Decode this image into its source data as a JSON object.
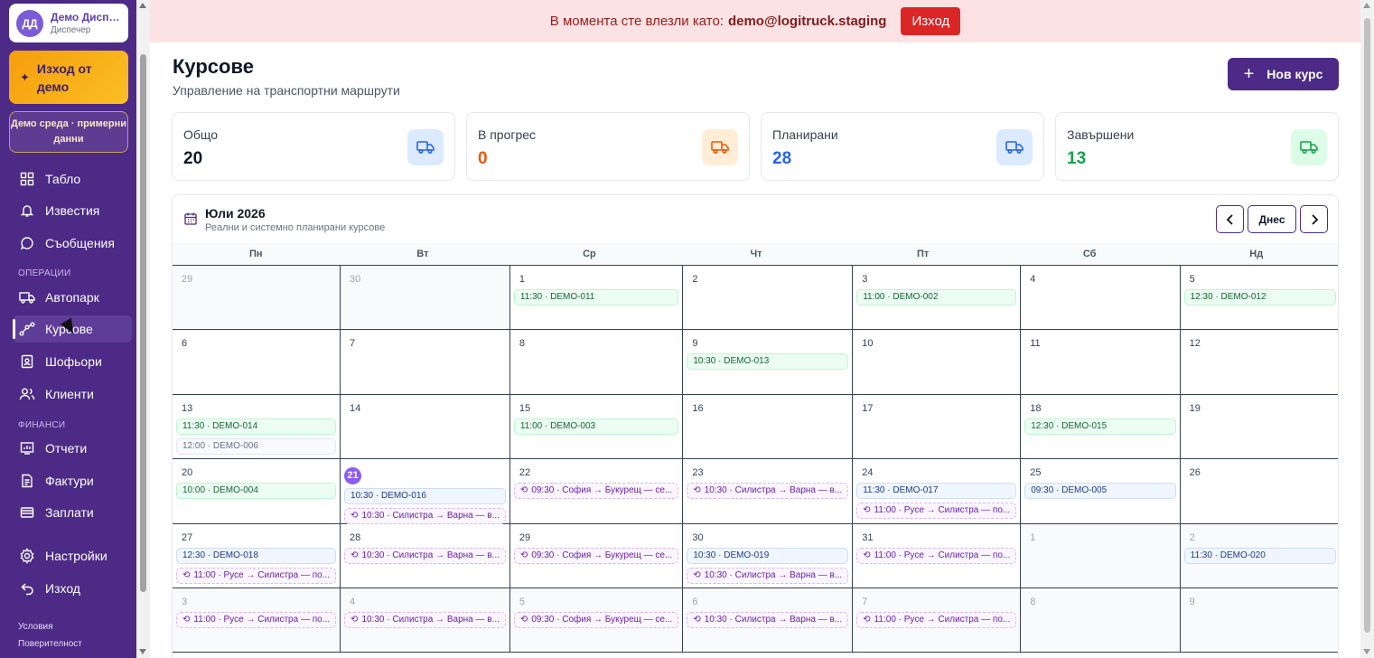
{
  "user": {
    "initials": "ДД",
    "name": "Демо Диспечер",
    "role": "Диспечер"
  },
  "sidebar": {
    "exit_demo": "Изход от демо",
    "demo_env": "Демо среда · примерни данни",
    "items_top": [
      {
        "label": "Табло",
        "icon": "dashboard-icon"
      },
      {
        "label": "Известия",
        "icon": "bell-icon"
      },
      {
        "label": "Съобщения",
        "icon": "chat-icon"
      }
    ],
    "section_operations": "ОПЕРАЦИИ",
    "items_ops": [
      {
        "label": "Автопарк",
        "icon": "truck-icon"
      },
      {
        "label": "Курсове",
        "icon": "route-icon"
      },
      {
        "label": "Шофьори",
        "icon": "id-badge-icon"
      },
      {
        "label": "Клиенти",
        "icon": "users-icon"
      }
    ],
    "section_finance": "ФИНАНСИ",
    "items_fin": [
      {
        "label": "Отчети",
        "icon": "report-icon"
      },
      {
        "label": "Фактури",
        "icon": "invoice-icon"
      },
      {
        "label": "Заплати",
        "icon": "wallet-icon"
      }
    ],
    "items_bottom": [
      {
        "label": "Настройки",
        "icon": "gear-icon"
      },
      {
        "label": "Изход",
        "icon": "logout-icon"
      }
    ],
    "footer": [
      "Условия",
      "Поверителност"
    ]
  },
  "banner": {
    "text": "В момента сте влезли като:",
    "email": "demo@logitruck.staging",
    "logout": "Изход"
  },
  "header": {
    "title": "Курсове",
    "subtitle": "Управление на транспортни маршрути",
    "new_button": "Нов курс"
  },
  "stats": [
    {
      "label": "Общо",
      "value": "20",
      "color": "#111827",
      "icon_bg": "#dbeafe",
      "icon_color": "#2563eb"
    },
    {
      "label": "В прогрес",
      "value": "0",
      "color": "#ea580c",
      "icon_bg": "#ffedd5",
      "icon_color": "#ea580c"
    },
    {
      "label": "Планирани",
      "value": "28",
      "color": "#2563eb",
      "icon_bg": "#dbeafe",
      "icon_color": "#2563eb"
    },
    {
      "label": "Завършени",
      "value": "13",
      "color": "#16a34a",
      "icon_bg": "#dcfce7",
      "icon_color": "#16a34a"
    }
  ],
  "calendar": {
    "title": "Юли 2026",
    "subtitle": "Реални и системно планирани курсове",
    "today_button": "Днес",
    "weekdays": [
      "Пн",
      "Вт",
      "Ср",
      "Чт",
      "Пт",
      "Сб",
      "Нд"
    ],
    "days": [
      {
        "n": "29",
        "other": true,
        "events": []
      },
      {
        "n": "30",
        "other": true,
        "events": []
      },
      {
        "n": "1",
        "events": [
          {
            "t": "11:30 · DEMO-011",
            "c": "green"
          }
        ]
      },
      {
        "n": "2",
        "events": []
      },
      {
        "n": "3",
        "events": [
          {
            "t": "11:00 · DEMO-002",
            "c": "green"
          }
        ]
      },
      {
        "n": "4",
        "events": []
      },
      {
        "n": "5",
        "events": [
          {
            "t": "12:30 · DEMO-012",
            "c": "green"
          }
        ]
      },
      {
        "n": "6",
        "events": []
      },
      {
        "n": "7",
        "events": []
      },
      {
        "n": "8",
        "events": []
      },
      {
        "n": "9",
        "events": [
          {
            "t": "10:30 · DEMO-013",
            "c": "green"
          }
        ]
      },
      {
        "n": "10",
        "events": []
      },
      {
        "n": "11",
        "events": []
      },
      {
        "n": "12",
        "events": []
      },
      {
        "n": "13",
        "events": [
          {
            "t": "11:30 · DEMO-014",
            "c": "green"
          },
          {
            "t": "12:00 · DEMO-006",
            "c": "gray"
          }
        ]
      },
      {
        "n": "14",
        "events": []
      },
      {
        "n": "15",
        "events": [
          {
            "t": "11:00 · DEMO-003",
            "c": "green"
          }
        ]
      },
      {
        "n": "16",
        "events": []
      },
      {
        "n": "17",
        "events": []
      },
      {
        "n": "18",
        "events": [
          {
            "t": "12:30 · DEMO-015",
            "c": "green"
          }
        ]
      },
      {
        "n": "19",
        "events": []
      },
      {
        "n": "20",
        "events": [
          {
            "t": "10:00 · DEMO-004",
            "c": "green"
          }
        ]
      },
      {
        "n": "21",
        "today": true,
        "events": [
          {
            "t": "10:30 · DEMO-016",
            "c": "blue"
          },
          {
            "t": "10:30 · Силистра → Варна — в...",
            "c": "purple"
          }
        ]
      },
      {
        "n": "22",
        "events": [
          {
            "t": "09:30 · София → Букурещ — се...",
            "c": "purple"
          }
        ]
      },
      {
        "n": "23",
        "events": [
          {
            "t": "10:30 · Силистра → Варна — в...",
            "c": "purple"
          }
        ]
      },
      {
        "n": "24",
        "events": [
          {
            "t": "11:30 · DEMO-017",
            "c": "blue"
          },
          {
            "t": "11:00 · Русе → Силистра — по...",
            "c": "purple"
          }
        ]
      },
      {
        "n": "25",
        "events": [
          {
            "t": "09:30 · DEMO-005",
            "c": "blue"
          }
        ]
      },
      {
        "n": "26",
        "events": []
      },
      {
        "n": "27",
        "events": [
          {
            "t": "12:30 · DEMO-018",
            "c": "blue"
          },
          {
            "t": "11:00 · Русе → Силистра — по...",
            "c": "purple"
          }
        ]
      },
      {
        "n": "28",
        "events": [
          {
            "t": "10:30 · Силистра → Варна — в...",
            "c": "purple"
          }
        ]
      },
      {
        "n": "29",
        "events": [
          {
            "t": "09:30 · София → Букурещ — се...",
            "c": "purple"
          }
        ]
      },
      {
        "n": "30",
        "events": [
          {
            "t": "10:30 · DEMO-019",
            "c": "blue"
          },
          {
            "t": "10:30 · Силистра → Варна — в...",
            "c": "purple"
          }
        ]
      },
      {
        "n": "31",
        "events": [
          {
            "t": "11:00 · Русе → Силистра — по...",
            "c": "purple"
          }
        ]
      },
      {
        "n": "1",
        "other": true,
        "events": []
      },
      {
        "n": "2",
        "other": true,
        "events": [
          {
            "t": "11:30 · DEMO-020",
            "c": "blue"
          }
        ]
      },
      {
        "n": "3",
        "other": true,
        "events": [
          {
            "t": "11:00 · Русе → Силистра — по...",
            "c": "purple"
          }
        ]
      },
      {
        "n": "4",
        "other": true,
        "events": [
          {
            "t": "10:30 · Силистра → Варна — в...",
            "c": "purple"
          }
        ]
      },
      {
        "n": "5",
        "other": true,
        "events": [
          {
            "t": "09:30 · София → Букурещ — се...",
            "c": "purple"
          }
        ]
      },
      {
        "n": "6",
        "other": true,
        "events": [
          {
            "t": "10:30 · Силистра → Варна — в...",
            "c": "purple"
          }
        ]
      },
      {
        "n": "7",
        "other": true,
        "events": [
          {
            "t": "11:00 · Русе → Силистра — по...",
            "c": "purple"
          }
        ]
      },
      {
        "n": "8",
        "other": true,
        "events": []
      },
      {
        "n": "9",
        "other": true,
        "events": []
      }
    ]
  },
  "colors": {
    "sidebar_bg": "#4c2a86",
    "accent": "#4c2a86",
    "banner_bg": "#fde2e4",
    "today": "#8b5cf6"
  }
}
